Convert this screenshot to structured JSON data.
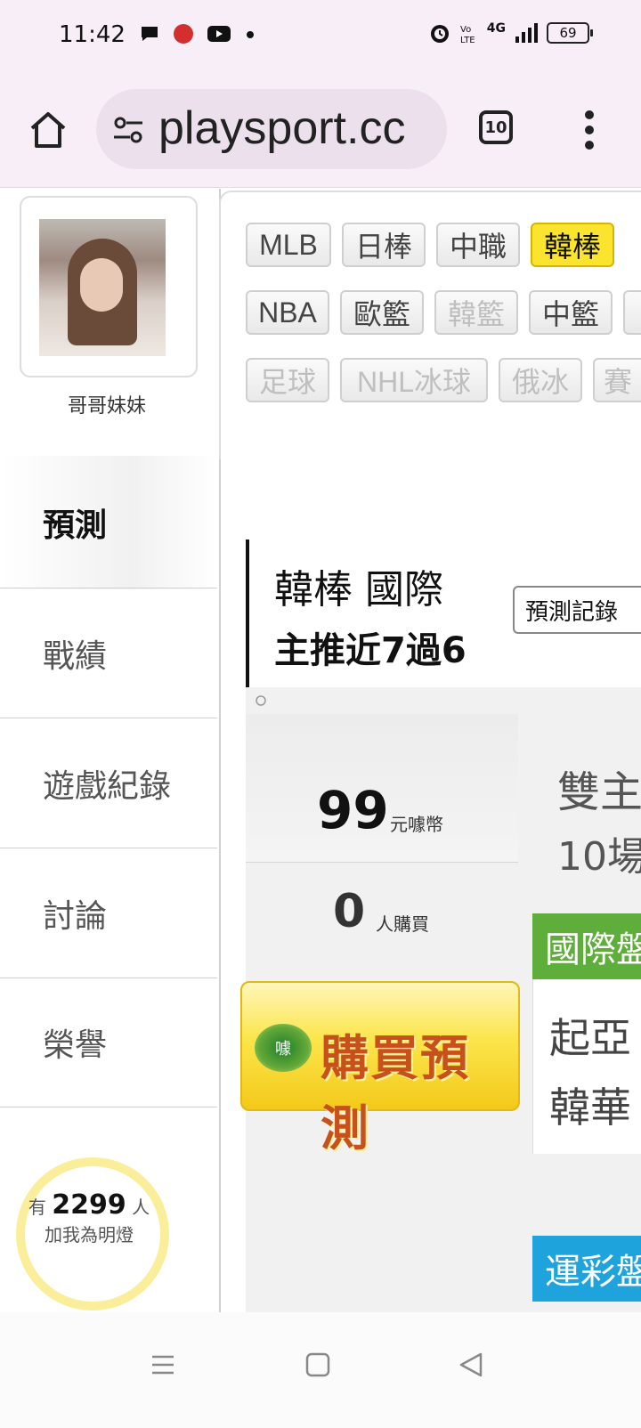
{
  "status_bar": {
    "time": "11:42",
    "battery": "69",
    "network": "4G"
  },
  "browser": {
    "url": "playsport.cc",
    "tab_count": "10"
  },
  "profile": {
    "username": "哥哥妹妹"
  },
  "sidebar": {
    "items": [
      {
        "label": "預測"
      },
      {
        "label": "戰績"
      },
      {
        "label": "遊戲紀錄"
      },
      {
        "label": "討論"
      },
      {
        "label": "榮譽"
      }
    ],
    "follow": {
      "prefix": "有",
      "count": "2299",
      "suffix": "人",
      "caption": "加我為明燈"
    }
  },
  "leagues": {
    "row1": [
      "MLB",
      "日棒",
      "中職",
      "韓棒"
    ],
    "row2": [
      "NBA",
      "歐籃",
      "韓籃",
      "中籃"
    ],
    "row3": [
      "足球",
      "NHL冰球",
      "俄冰",
      "賽"
    ]
  },
  "prediction": {
    "league": "韓棒 國際",
    "streak": "主推近7過6",
    "record_button": "預測記錄"
  },
  "purchase": {
    "price": "99",
    "price_unit": "元噱幣",
    "buyers": "0",
    "buyers_unit": "人購買",
    "buy_label": "購買預測",
    "seal_char": "噱"
  },
  "details": {
    "stat1": "雙主",
    "stat2": "10場",
    "intl_header": "國際盤",
    "team1": "起亞",
    "team2": "韓華",
    "sport_header": "運彩盤"
  },
  "colors": {
    "active_chip": "#fbe42e",
    "intl_header": "#5fad3a",
    "sport_header": "#1fa3dc",
    "buy_text": "#c8501a"
  }
}
